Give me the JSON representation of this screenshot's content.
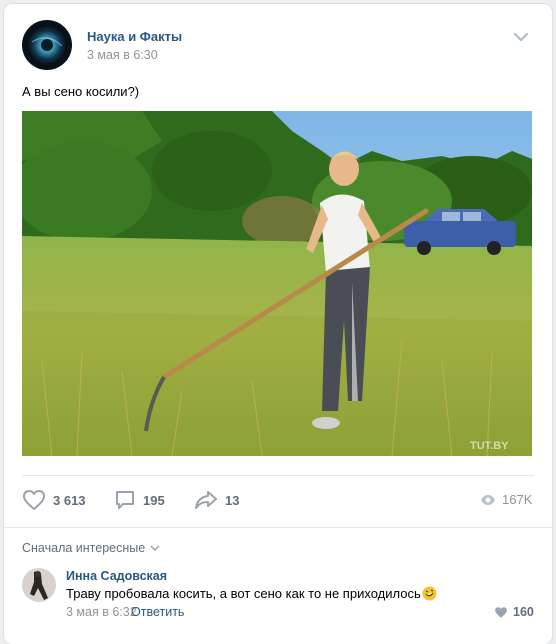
{
  "post": {
    "author": "Наука и Факты",
    "date": "3 мая в 6:30",
    "text": "А вы сено косили?)",
    "photo_watermark": "TUT.BY"
  },
  "actions": {
    "likes": "3 613",
    "comments": "195",
    "shares": "13",
    "views": "167K"
  },
  "comments_section": {
    "sort_label": "Сначала интересные",
    "comment": {
      "author": "Инна Садовская",
      "text": "Траву пробовала косить, а вот сено как то не приходилось",
      "emoji": "rofl-emoji",
      "date": "3 мая в 6:32",
      "reply_label": "Ответить",
      "likes": "160"
    }
  },
  "colors": {
    "link": "#2a5885",
    "secondary": "#939393",
    "action_text": "#626d7a",
    "background": "#edeef0"
  }
}
